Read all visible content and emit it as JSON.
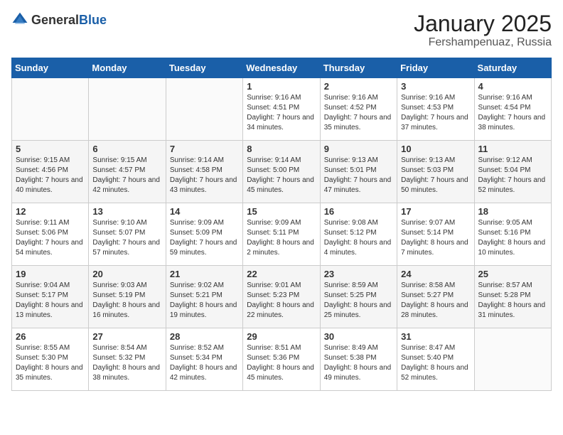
{
  "header": {
    "logo_general": "General",
    "logo_blue": "Blue",
    "title": "January 2025",
    "subtitle": "Fershampenuaz, Russia"
  },
  "weekdays": [
    "Sunday",
    "Monday",
    "Tuesday",
    "Wednesday",
    "Thursday",
    "Friday",
    "Saturday"
  ],
  "weeks": [
    [
      {
        "day": "",
        "info": ""
      },
      {
        "day": "",
        "info": ""
      },
      {
        "day": "",
        "info": ""
      },
      {
        "day": "1",
        "info": "Sunrise: 9:16 AM\nSunset: 4:51 PM\nDaylight: 7 hours\nand 34 minutes."
      },
      {
        "day": "2",
        "info": "Sunrise: 9:16 AM\nSunset: 4:52 PM\nDaylight: 7 hours\nand 35 minutes."
      },
      {
        "day": "3",
        "info": "Sunrise: 9:16 AM\nSunset: 4:53 PM\nDaylight: 7 hours\nand 37 minutes."
      },
      {
        "day": "4",
        "info": "Sunrise: 9:16 AM\nSunset: 4:54 PM\nDaylight: 7 hours\nand 38 minutes."
      }
    ],
    [
      {
        "day": "5",
        "info": "Sunrise: 9:15 AM\nSunset: 4:56 PM\nDaylight: 7 hours\nand 40 minutes."
      },
      {
        "day": "6",
        "info": "Sunrise: 9:15 AM\nSunset: 4:57 PM\nDaylight: 7 hours\nand 42 minutes."
      },
      {
        "day": "7",
        "info": "Sunrise: 9:14 AM\nSunset: 4:58 PM\nDaylight: 7 hours\nand 43 minutes."
      },
      {
        "day": "8",
        "info": "Sunrise: 9:14 AM\nSunset: 5:00 PM\nDaylight: 7 hours\nand 45 minutes."
      },
      {
        "day": "9",
        "info": "Sunrise: 9:13 AM\nSunset: 5:01 PM\nDaylight: 7 hours\nand 47 minutes."
      },
      {
        "day": "10",
        "info": "Sunrise: 9:13 AM\nSunset: 5:03 PM\nDaylight: 7 hours\nand 50 minutes."
      },
      {
        "day": "11",
        "info": "Sunrise: 9:12 AM\nSunset: 5:04 PM\nDaylight: 7 hours\nand 52 minutes."
      }
    ],
    [
      {
        "day": "12",
        "info": "Sunrise: 9:11 AM\nSunset: 5:06 PM\nDaylight: 7 hours\nand 54 minutes."
      },
      {
        "day": "13",
        "info": "Sunrise: 9:10 AM\nSunset: 5:07 PM\nDaylight: 7 hours\nand 57 minutes."
      },
      {
        "day": "14",
        "info": "Sunrise: 9:09 AM\nSunset: 5:09 PM\nDaylight: 7 hours\nand 59 minutes."
      },
      {
        "day": "15",
        "info": "Sunrise: 9:09 AM\nSunset: 5:11 PM\nDaylight: 8 hours\nand 2 minutes."
      },
      {
        "day": "16",
        "info": "Sunrise: 9:08 AM\nSunset: 5:12 PM\nDaylight: 8 hours\nand 4 minutes."
      },
      {
        "day": "17",
        "info": "Sunrise: 9:07 AM\nSunset: 5:14 PM\nDaylight: 8 hours\nand 7 minutes."
      },
      {
        "day": "18",
        "info": "Sunrise: 9:05 AM\nSunset: 5:16 PM\nDaylight: 8 hours\nand 10 minutes."
      }
    ],
    [
      {
        "day": "19",
        "info": "Sunrise: 9:04 AM\nSunset: 5:17 PM\nDaylight: 8 hours\nand 13 minutes."
      },
      {
        "day": "20",
        "info": "Sunrise: 9:03 AM\nSunset: 5:19 PM\nDaylight: 8 hours\nand 16 minutes."
      },
      {
        "day": "21",
        "info": "Sunrise: 9:02 AM\nSunset: 5:21 PM\nDaylight: 8 hours\nand 19 minutes."
      },
      {
        "day": "22",
        "info": "Sunrise: 9:01 AM\nSunset: 5:23 PM\nDaylight: 8 hours\nand 22 minutes."
      },
      {
        "day": "23",
        "info": "Sunrise: 8:59 AM\nSunset: 5:25 PM\nDaylight: 8 hours\nand 25 minutes."
      },
      {
        "day": "24",
        "info": "Sunrise: 8:58 AM\nSunset: 5:27 PM\nDaylight: 8 hours\nand 28 minutes."
      },
      {
        "day": "25",
        "info": "Sunrise: 8:57 AM\nSunset: 5:28 PM\nDaylight: 8 hours\nand 31 minutes."
      }
    ],
    [
      {
        "day": "26",
        "info": "Sunrise: 8:55 AM\nSunset: 5:30 PM\nDaylight: 8 hours\nand 35 minutes."
      },
      {
        "day": "27",
        "info": "Sunrise: 8:54 AM\nSunset: 5:32 PM\nDaylight: 8 hours\nand 38 minutes."
      },
      {
        "day": "28",
        "info": "Sunrise: 8:52 AM\nSunset: 5:34 PM\nDaylight: 8 hours\nand 42 minutes."
      },
      {
        "day": "29",
        "info": "Sunrise: 8:51 AM\nSunset: 5:36 PM\nDaylight: 8 hours\nand 45 minutes."
      },
      {
        "day": "30",
        "info": "Sunrise: 8:49 AM\nSunset: 5:38 PM\nDaylight: 8 hours\nand 49 minutes."
      },
      {
        "day": "31",
        "info": "Sunrise: 8:47 AM\nSunset: 5:40 PM\nDaylight: 8 hours\nand 52 minutes."
      },
      {
        "day": "",
        "info": ""
      }
    ]
  ]
}
